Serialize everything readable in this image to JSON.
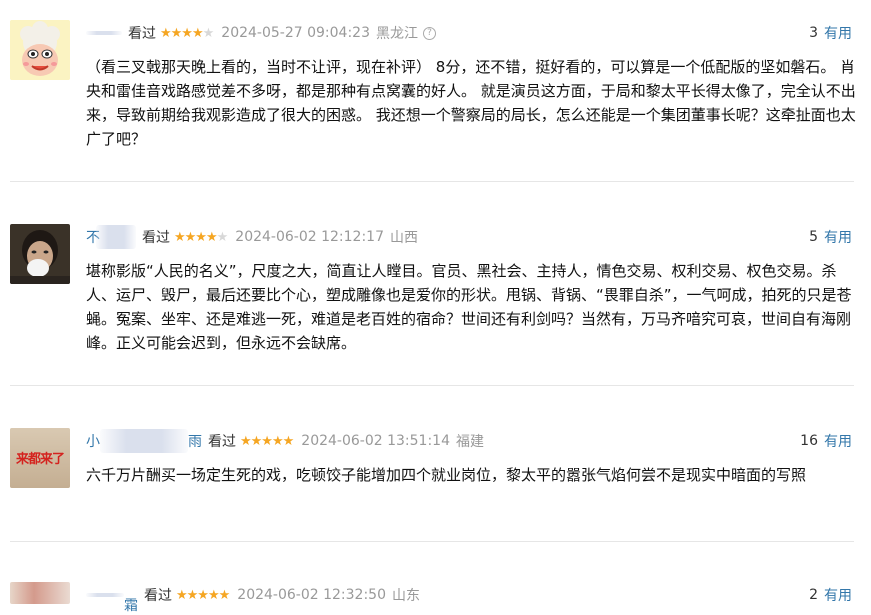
{
  "reviews": [
    {
      "username_visible": "",
      "watched": "看过",
      "stars": "★★★★",
      "stars_empty": "★",
      "rating": 4,
      "time": "2024-05-27 09:04:23",
      "location": "黑龙江",
      "info_icon": "?",
      "votes": "3",
      "useful": "有用",
      "content": "（看三叉戟那天晚上看的，当时不让评，现在补评） 8分，还不错，挺好看的，可以算是一个低配版的坚如磐石。 肖央和雷佳音戏路感觉差不多呀，都是那种有点窝囊的好人。 就是演员这方面，于局和黎太平长得太像了，完全认不出来，导致前期给我观影造成了很大的困惑。 我还想一个警察局的局长，怎么还能是一个集团董事长呢？这牵扯面也太广了吧？"
    },
    {
      "username_visible": "不",
      "watched": "看过",
      "stars": "★★★★",
      "stars_empty": "★",
      "rating": 4,
      "time": "2024-06-02 12:12:17",
      "location": "山西",
      "votes": "5",
      "useful": "有用",
      "content": "堪称影版“人民的名义”，尺度之大，简直让人瞠目。官员、黑社会、主持人，情色交易、权利交易、权色交易。杀人、运尸、毁尸，最后还要比个心，塑成雕像也是爱你的形状。甩锅、背锅、“畏罪自杀”，一气呵成，拍死的只是苍蝇。冤案、坐牢、还是难逃一死，难道是老百姓的宿命？世间还有利剑吗？当然有，万马齐喑究可哀，世间自有海刚峰。正义可能会迟到，但永远不会缺席。"
    },
    {
      "username_visible": "小",
      "username_tail": "雨",
      "avatar_text": "来都来了",
      "watched": "看过",
      "stars": "★★★★★",
      "stars_empty": "",
      "rating": 5,
      "time": "2024-06-02 13:51:14",
      "location": "福建",
      "votes": "16",
      "useful": "有用",
      "content": "六千万片酬买一场定生死的戏，吃顿饺子能增加四个就业岗位，黎太平的嚣张气焰何尝不是现实中暗面的写照"
    },
    {
      "username_visible": "",
      "username_tail": "霜",
      "watched": "看过",
      "stars": "★★★★★",
      "stars_empty": "",
      "rating": 5,
      "time": "2024-06-02 12:32:50",
      "location": "山东",
      "votes": "2",
      "useful": "有用"
    }
  ]
}
